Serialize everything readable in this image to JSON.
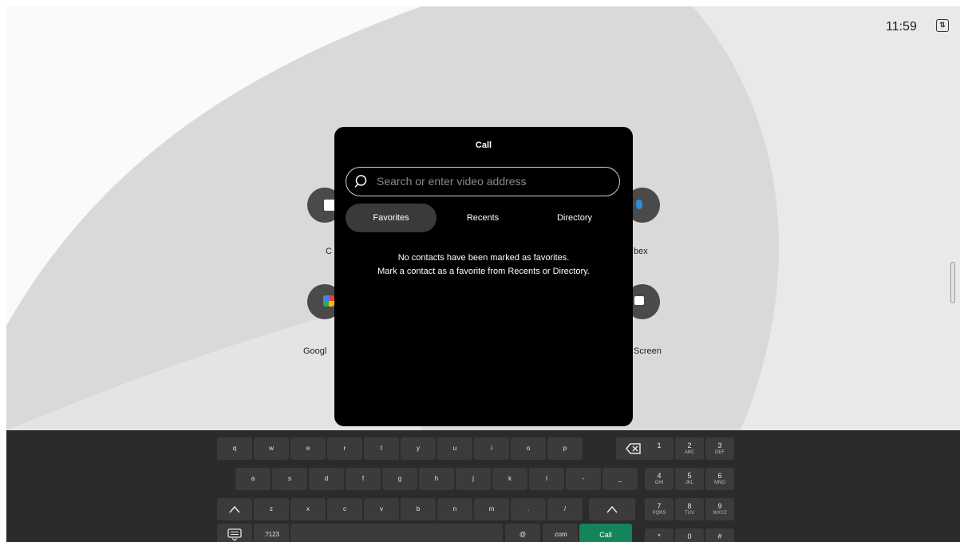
{
  "status": {
    "time": "11:59"
  },
  "apps": [
    {
      "icon": "call-icon",
      "label": "C"
    },
    {
      "icon": "webex-icon",
      "label": "bex"
    },
    {
      "icon": "google-meet-icon",
      "label": "Googl"
    },
    {
      "icon": "share-screen-icon",
      "label": "Screen"
    }
  ],
  "dialog": {
    "title": "Call",
    "search": {
      "placeholder": "Search or enter video address",
      "value": ""
    },
    "tabs": [
      {
        "label": "Favorites",
        "active": true
      },
      {
        "label": "Recents",
        "active": false
      },
      {
        "label": "Directory",
        "active": false
      }
    ],
    "empty_message": {
      "line1": "No contacts have been marked as favorites.",
      "line2": "Mark a contact as a favorite from Recents or Directory."
    }
  },
  "keyboard": {
    "row1": [
      "q",
      "w",
      "e",
      "r",
      "t",
      "y",
      "u",
      "i",
      "o",
      "p"
    ],
    "row2": [
      "a",
      "s",
      "d",
      "f",
      "g",
      "h",
      "j",
      "k",
      "l",
      "-",
      "_"
    ],
    "row3": [
      "z",
      "x",
      "c",
      "v",
      "b",
      "n",
      "m",
      ".",
      "/"
    ],
    "bottom": {
      "mode": ".?123",
      "at": "@",
      "com": ".com",
      "call": "Call"
    },
    "numpad": [
      {
        "d": "1",
        "l": ""
      },
      {
        "d": "2",
        "l": "ABC"
      },
      {
        "d": "3",
        "l": "DEF"
      },
      {
        "d": "4",
        "l": "GHI"
      },
      {
        "d": "5",
        "l": "JKL"
      },
      {
        "d": "6",
        "l": "MNO"
      },
      {
        "d": "7",
        "l": "PQRS"
      },
      {
        "d": "8",
        "l": "TUV"
      },
      {
        "d": "9",
        "l": "WXYZ"
      },
      {
        "d": "*",
        "l": ""
      },
      {
        "d": "0",
        "l": "+"
      },
      {
        "d": "#",
        "l": ""
      }
    ]
  },
  "colors": {
    "call_button": "#16845a",
    "dialog_bg": "#000000",
    "active_tab": "#3a3a3a"
  }
}
